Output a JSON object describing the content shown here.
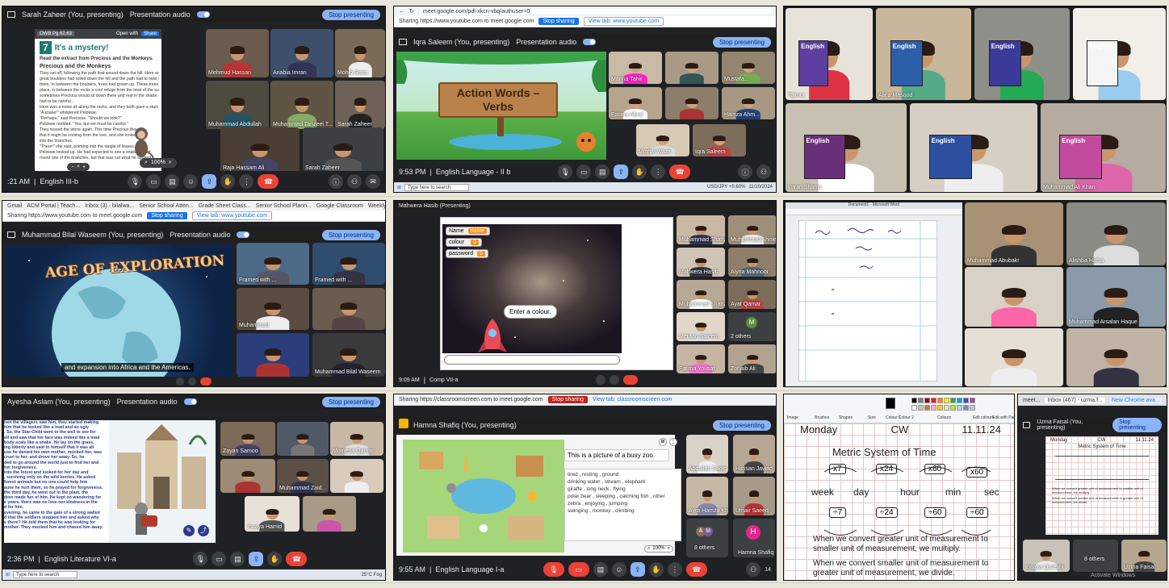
{
  "panels": {
    "p1": {
      "presenter": "Sarah Zaheer (You, presenting)",
      "presentation_audio": "Presentation audio",
      "stop_label": "Stop presenting",
      "doc_title": "OWB Pg 62,63",
      "open_label": "Open with",
      "share_label": "Share",
      "lesson_number": "7",
      "lesson_title": "It's a mystery!",
      "instruction": "Read the extract from Precious and the Monkeys.",
      "story_title": "Precious and the Monkeys",
      "story_lines": [
        "They set off, following the path that wound down the hill. Here and there",
        "great boulders had rolled down the hill and the path had to twist around",
        "them. In between the boulders, trees had grown up. These trees made the",
        "place, in between the rocks a cool refuge from the heat of the sun. And",
        "sometimes Precious would sit down there and rest in the shade. But she",
        "had to be careful...",
        "Here was a noise all along the rocks, and they both gave a start.",
        "\"A snake!\" whispered Pelokwe.",
        "\"Perhaps,\" said Precious. \"Should we look?\"",
        "Pelokwe nodded. \"Yes, but we must be careful.\"",
        "They tossed the stone again. This time Precious thought",
        "that it might be coming from the tree, and she looked up",
        "into the branches.",
        "\"There!\" she said, pointing into the tangle of leaves.",
        "Pelokwe looked up. He had expected to see a snake wound",
        "round one of the branches, but that was not what he spotted."
      ],
      "zoom": "100%",
      "time": ":21 AM",
      "class": "English III-b",
      "tiles": [
        "Mehmud Hassan",
        "Anabia Imran",
        "Mohib Raza",
        "Muhammad Abdullah",
        "Muhammad Tanzeel T...",
        "Sarah Zaheer",
        "Raja Hassam Ali",
        "Sarah Zaheer"
      ]
    },
    "p2": {
      "url": "meet.google.com/pdl-xkcn-vbq/authuser=0",
      "sharing_text": "Sharing https://www.youtube.com to meet.google.com",
      "stop_sharing": "Stop sharing",
      "view_tab": "View tab: www.youtube.com",
      "presenter": "Iqra Saleem (You, presenting)",
      "presentation_audio": "Presentation audio",
      "stop_label": "Stop presenting",
      "sign_line1": "Action Words –",
      "sign_line2": "Verbs",
      "time": "9:53 PM",
      "class": "English Language - II b",
      "search": "Type here to search",
      "ticker": "USD/JPY +0.60%",
      "clock": "11/10/2024",
      "tiles": [
        "Manna Tahir",
        "",
        "Mustafa...",
        "Fatima Abrar",
        "",
        "Hamza Ahm...",
        "",
        "Minhal Wazir",
        "Iqra Saleem"
      ]
    },
    "p3": {
      "tiles": [
        "Taimur",
        "Alina Masood",
        "",
        "",
        "Imran Shams",
        "",
        "Muhammad Ali Khan",
        "Ayesha Tahir"
      ],
      "book_word": "English"
    },
    "p4": {
      "bookmarks": [
        "Gmail",
        "ACM Portal | Teach...",
        "Inbox (3) - bilalwa...",
        "Senior School Atten...",
        "Grade Sheet Class...",
        "Senior School Plann...",
        "Google Classroom",
        "Weekly Overview -..."
      ],
      "sharing_text": "Sharing https://www.youtube.com to meet.google.com",
      "stop_sharing": "Stop sharing",
      "view_tab": "View tab: www.youtube.com",
      "presenter": "Muhammad Bilal Waseem (You, presenting)",
      "presentation_audio": "Presentation audio",
      "stop_label": "Stop presenting",
      "video_title": "AGE OF EXPLORATION",
      "caption": "and expansion into Africa and the Americas.",
      "tiles": [
        "Framed with ...",
        "Framed with ...",
        "Muhammad",
        "",
        "Muhammad Bilal Waseem",
        ""
      ]
    },
    "p5": {
      "presenter": "Mahwera Hasib (Presenting)",
      "var_name_label": "Name",
      "var_name_value": "name",
      "var_colour_label": "colour",
      "var_colour_value": "0",
      "var_password_label": "password",
      "var_password_value": "0",
      "speech": "Enter a colour.",
      "time": "9:09 AM",
      "class": "Comp VII-a",
      "tiles": [
        "Muhammad Shahzy Aamir",
        "Muhammad Ahmed Khan",
        "Mahwera Hasib",
        "Aiyna Mahnoor",
        "Muhammad Shahzaib...",
        "Ayat Qamar",
        "Meraan Saleem",
        "2 others",
        "Fatima Yousaf",
        "Zohaib Ali"
      ],
      "others_initial": "M",
      "others_label": "2 others"
    },
    "p6": {
      "window_title": "Document1 - Microsoft Word",
      "tiles": [
        "Muhammad Abubakr",
        "Alishba Hafsa",
        "",
        "Muhammad Arsalan Haque",
        "",
        ""
      ]
    },
    "p7": {
      "presenter": "Ayesha Aslam (You, presenting)",
      "presentation_audio": "Presentation audio",
      "stop_label": "Stop presenting",
      "text_lines": [
        "hen the villagers saw him, they started making",
        "him that he looked like a toad and an ugly",
        ". So, the Star-Child went to the well to see for",
        "elf and saw that his face was indeed like a toad",
        "body scaly like a snake. He lay on the grass,",
        "ing bitterly and said to himself that it was all",
        "use he denied his own mother, mocked her, was",
        "cruel to her, and drove her away. So, he",
        "ded to go around the world just to find her and",
        "her forgiveness.",
        "",
        "into the forest and looked for her day and",
        ", surviving only on the wild berries. He asked",
        "forest animals but no one could help him",
        "ause he hurt them, so he prayed for forgiveness.",
        "the third day, he went out in the plain, the",
        "dren made fun of him. He kept on wandering for",
        "e years, there was no love nor kindness in the",
        "d for him.",
        "",
        "evening, he came to the gate of a strong walled",
        "d that the soldiers stopped him and asked why",
        "s there? He told them that he was looking for",
        "mother. They mocked him and chased him away."
      ],
      "time": "2:36 PM",
      "class": "English Literature VI-a",
      "search": "Type here to search",
      "weather": "25°C Fog",
      "tiles": [
        "Zayan Samoo",
        "",
        "Momena Qamar",
        "",
        "Muhammad Zaid...",
        "",
        "Inaaya Hamid",
        ""
      ]
    },
    "p8": {
      "sharing_text": "Sharing https://classroomscreen.com to meet.google.com",
      "stop_sharing": "Stop sharing",
      "view_tab": "View tab: classroomscreen.com",
      "presenter": "Hamna Shafiq (You, presenting)",
      "stop_label": "Stop presenting",
      "caption_title": "This is a picture of a busy zoo.",
      "caption_lines": [
        "tired , resting , ground",
        "drinking water , stream , elephant",
        "giraffe , long neck , flying",
        "polar bear , sleeping , catching fish , other",
        "zebra , enjoying , jumping",
        "swinging , monkey , climbing"
      ],
      "zoom": "100%",
      "time": "9:55 AM",
      "class": "English Language I-a",
      "tiles": [
        "Abdullah Saqib",
        "Hassan Jawad",
        "Ayra Hamza Khan",
        "Umair Saeed",
        "8 others",
        "Hamna Shafiq"
      ],
      "others_initials": [
        "A",
        "M"
      ],
      "others_label": "8 others",
      "host_initial": "H",
      "host_name": "Hamna Shafiq",
      "badge_count": "14"
    },
    "p9": {
      "day": "Monday",
      "cw": "CW",
      "date": "11.11.24",
      "title": "Metric System of Time",
      "units": [
        "week",
        "day",
        "hour",
        "min",
        "sec"
      ],
      "multipliers": [
        "x7",
        "x24",
        "x60",
        "x60"
      ],
      "dividers": [
        "÷7",
        "÷24",
        "÷60",
        "÷60"
      ],
      "rule1": "When we convert greater unit of measurement to smaller unit of measurement, we multiply.",
      "rule2": "When we convert smaller unit of measurement to greater unit of measurement, we divide.",
      "ribbon_labels": [
        "Image",
        "Brushes",
        "Shapes",
        "Size",
        "Colour 1",
        "Colour 2",
        "Colours",
        "Edit colours",
        "Edit with Paint 3D"
      ],
      "palette": [
        "#000000",
        "#7f7f7f",
        "#880015",
        "#ed1c24",
        "#ff7f27",
        "#fff200",
        "#22b14c",
        "#00a2e8",
        "#3f48cc",
        "#a349a4",
        "#ffffff",
        "#c3c3c3",
        "#b97a57",
        "#ffaec9",
        "#ffc90e",
        "#efe4b0",
        "#b5e61d",
        "#99d9ea",
        "#7092be",
        "#c8bfe7"
      ]
    },
    "p10": {
      "tab_title": "Inbox (467) - uzma.f...",
      "tab2": "meet...",
      "new_chrome": "New Chrome ava...",
      "presenter": "Uzma Faisal (You, presenting)",
      "stop_label": "Stop presenting",
      "mini_day": "Monday",
      "mini_cw": "CW",
      "mini_date": "11.11.24",
      "mini_title": "Metric System of Time",
      "activate": "Activate Windows",
      "tiles": [
        "Inaaya Qureshi",
        "8 others",
        "Uzma Faisal"
      ],
      "others_label": "8 others"
    }
  },
  "colors": {
    "meet_dark": "#202124",
    "meet_blue": "#8ab4f8",
    "end_call_red": "#ea4335",
    "banner_green": "#7dc242"
  }
}
